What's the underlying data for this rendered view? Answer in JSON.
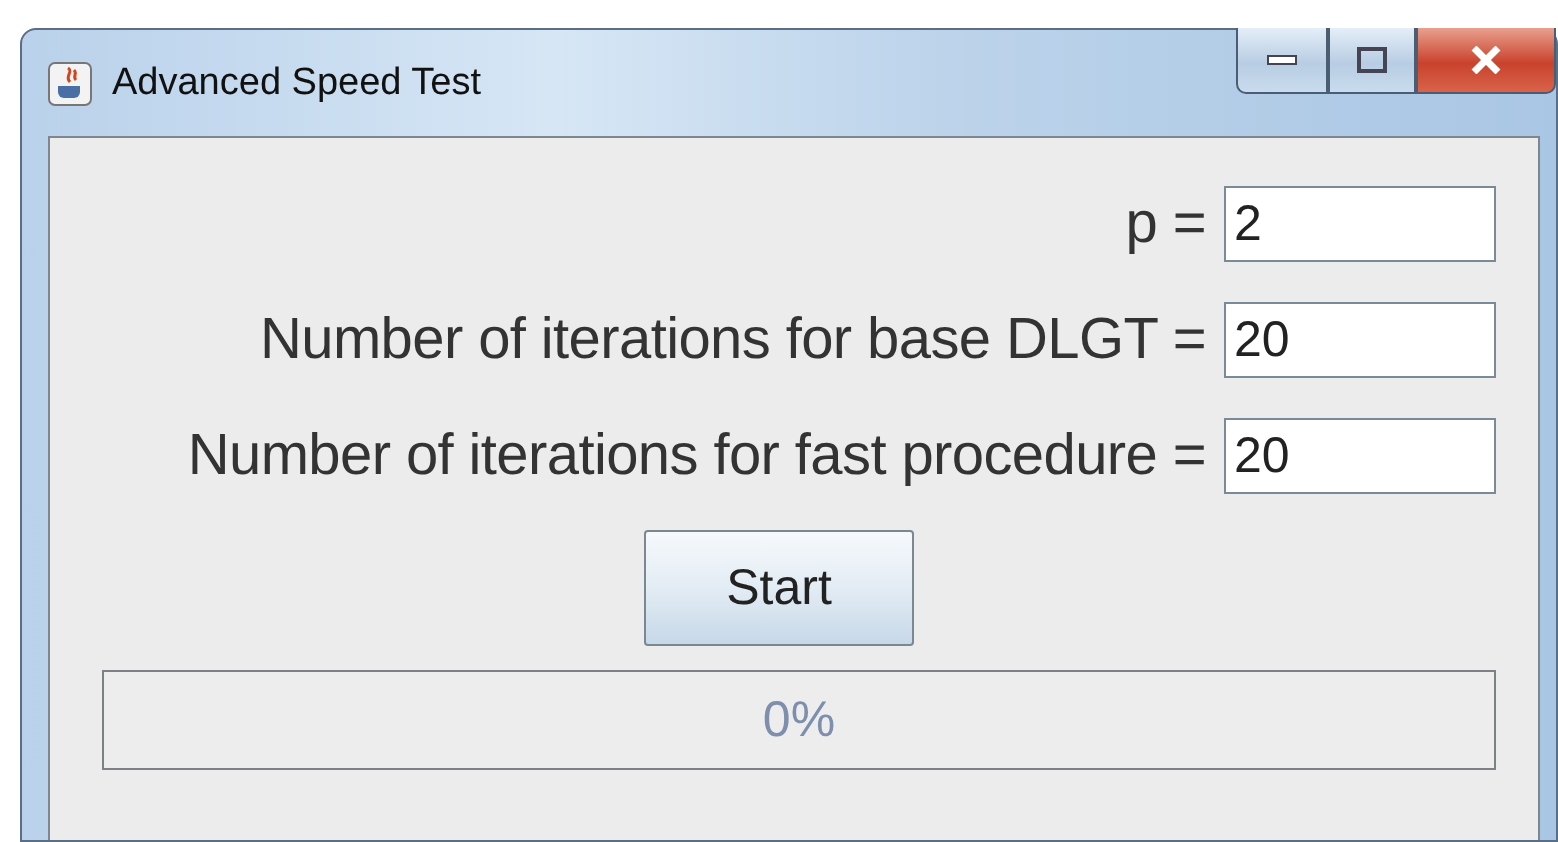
{
  "window": {
    "title": "Advanced Speed Test"
  },
  "fields": [
    {
      "label": "p =",
      "value": "2"
    },
    {
      "label": "Number of iterations for base DLGT =",
      "value": "20"
    },
    {
      "label": "Number of iterations for fast procedure =",
      "value": "20"
    }
  ],
  "start_button": "Start",
  "progress": {
    "level": 0,
    "text": "0%"
  }
}
